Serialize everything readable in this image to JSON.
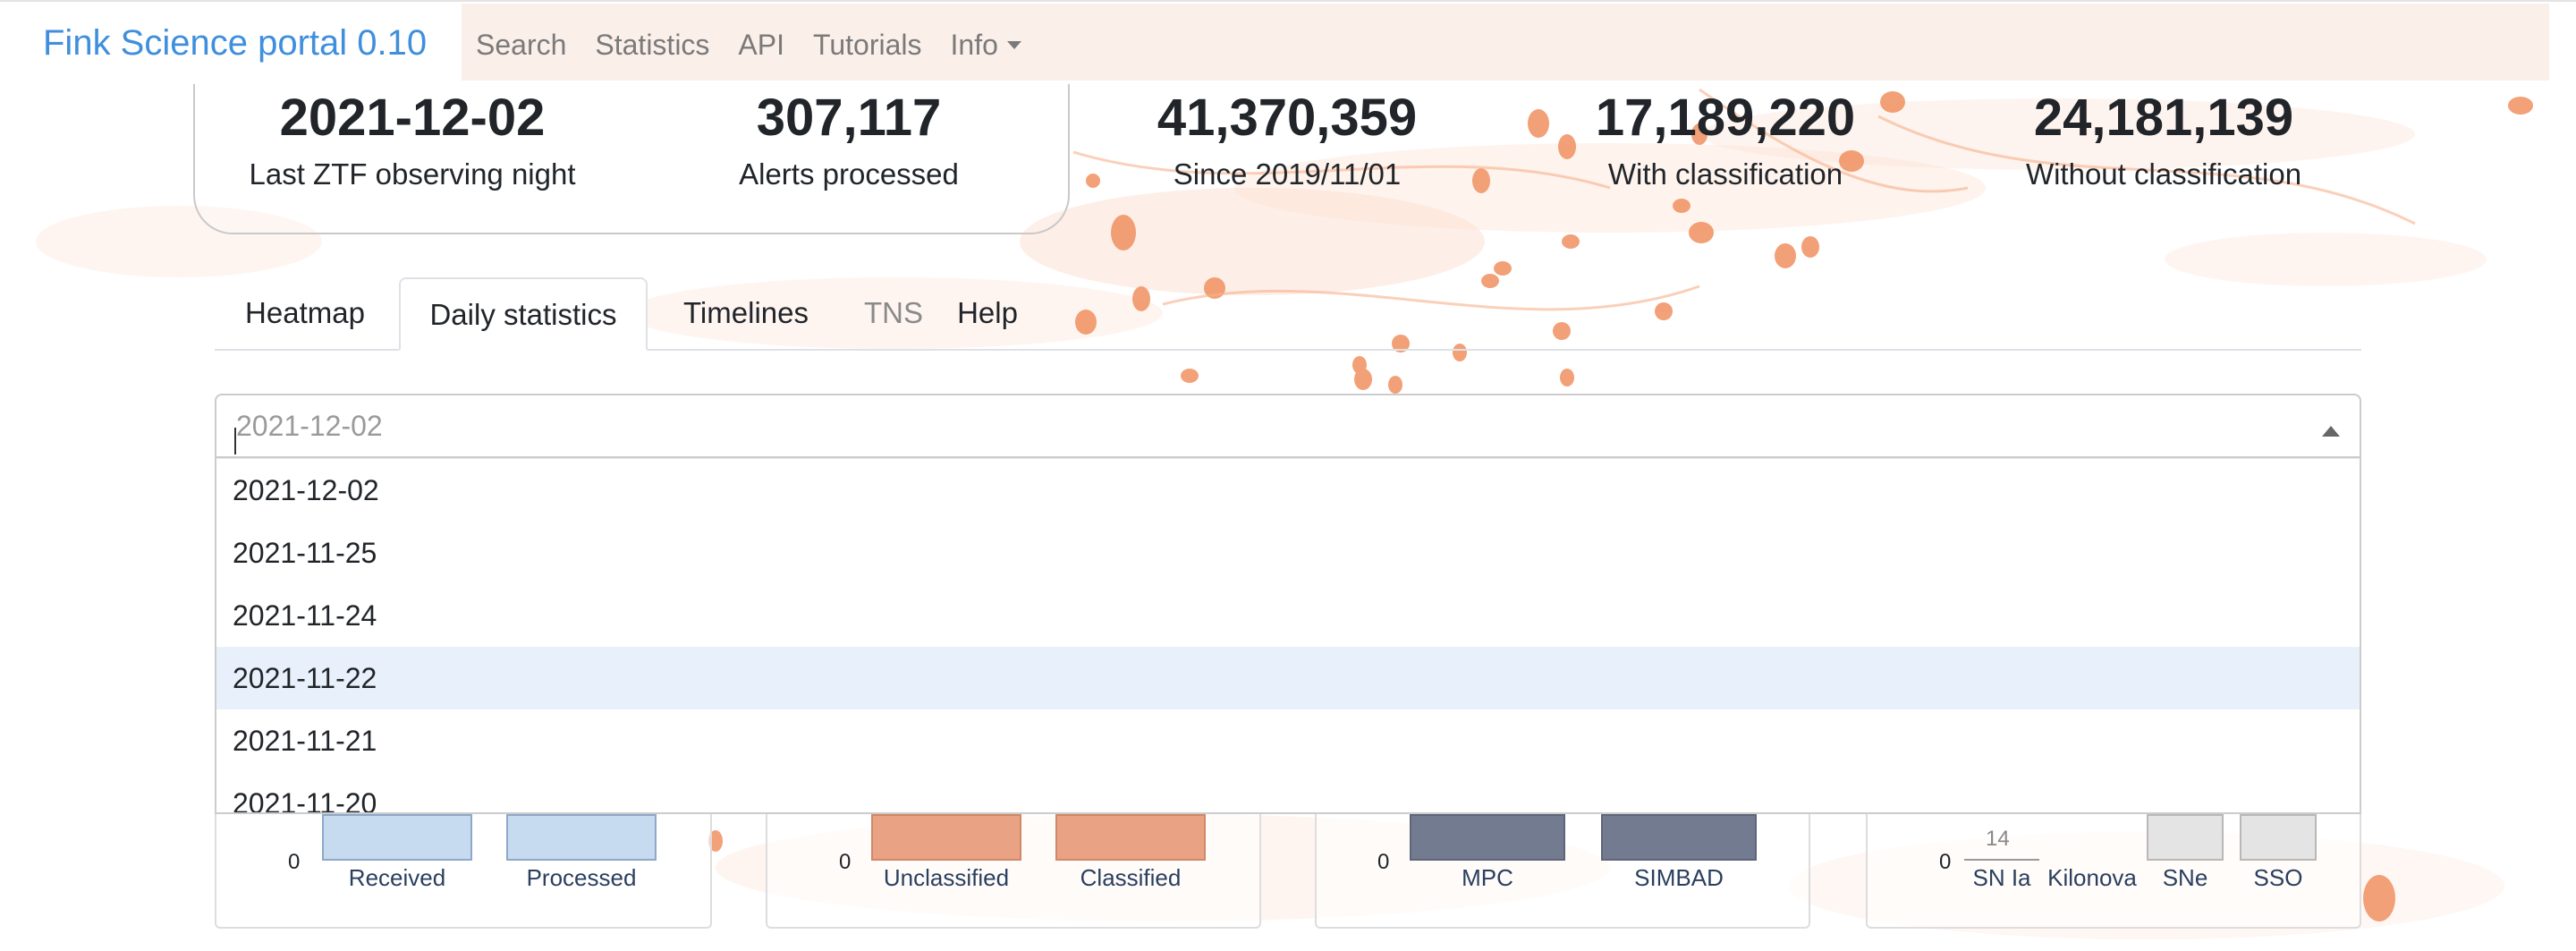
{
  "navbar": {
    "brand": "Fink Science portal 0.10",
    "links": [
      "Search",
      "Statistics",
      "API",
      "Tutorials",
      "Info"
    ]
  },
  "stats": [
    {
      "value": "2021-12-02",
      "label": "Last ZTF observing night"
    },
    {
      "value": "307,117",
      "label": "Alerts processed"
    },
    {
      "value": "41,370,359",
      "label": "Since 2019/11/01"
    },
    {
      "value": "17,189,220",
      "label": "With classification"
    },
    {
      "value": "24,181,139",
      "label": "Without classification"
    }
  ],
  "tabs": [
    "Heatmap",
    "Daily statistics",
    "Timelines",
    "TNS",
    "Help"
  ],
  "date_select": {
    "placeholder": "2021-12-02",
    "options": [
      "2021-12-02",
      "2021-11-25",
      "2021-11-24",
      "2021-11-22",
      "2021-11-21",
      "2021-11-20"
    ],
    "highlighted": "2021-11-22"
  },
  "cards": [
    {
      "zero": "0",
      "bars": [
        "Received",
        "Processed"
      ],
      "color": "#c6dbef"
    },
    {
      "zero": "0",
      "bars": [
        "Unclassified",
        "Classified"
      ],
      "color": "#e9a283"
    },
    {
      "zero": "0",
      "bars": [
        "MPC",
        "SIMBAD"
      ],
      "color": "#737b90"
    },
    {
      "zero": "0",
      "bars": [
        "SN Ia",
        "Kilonova",
        "SNe",
        "SSO"
      ],
      "value_label": "14",
      "color": "#e4e4e4"
    }
  ],
  "colors": {
    "brand": "#3f8fdc",
    "highlight": "#e8f1fb",
    "background_splash": "#f4a274"
  }
}
